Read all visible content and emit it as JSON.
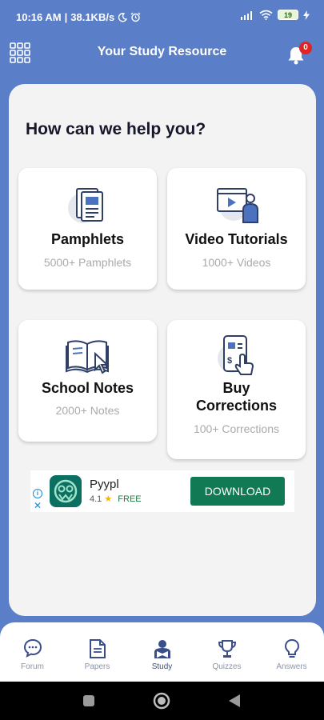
{
  "status_bar": {
    "time": "10:16 AM",
    "speed": "38.1KB/s",
    "battery": "19"
  },
  "header": {
    "title": "Your Study Resource",
    "notification_count": "0"
  },
  "main": {
    "heading": "How can we help you?",
    "cards": [
      {
        "title": "Pamphlets",
        "subtitle": "5000+ Pamphlets"
      },
      {
        "title": "Video Tutorials",
        "subtitle": "1000+ Videos"
      },
      {
        "title": "School Notes",
        "subtitle": "2000+ Notes"
      },
      {
        "title": "Buy Corrections",
        "subtitle": "100+  Corrections"
      }
    ]
  },
  "ad": {
    "app_name": "Pyypl",
    "rating": "4.1",
    "price": "FREE",
    "download_label": "DOWNLOAD"
  },
  "bottom_nav": {
    "items": [
      {
        "label": "Forum",
        "icon": "chat-bubble-icon"
      },
      {
        "label": "Papers",
        "icon": "document-icon"
      },
      {
        "label": "Study",
        "icon": "study-icon",
        "active": true
      },
      {
        "label": "Quizzes",
        "icon": "trophy-icon"
      },
      {
        "label": "Answers",
        "icon": "lightbulb-icon"
      }
    ]
  },
  "colors": {
    "brand": "#5a7ec7",
    "nav_active": "#3a4e8c",
    "nav_inactive": "#8a93a8",
    "ad_button": "#117a55",
    "badge": "#e02424"
  }
}
